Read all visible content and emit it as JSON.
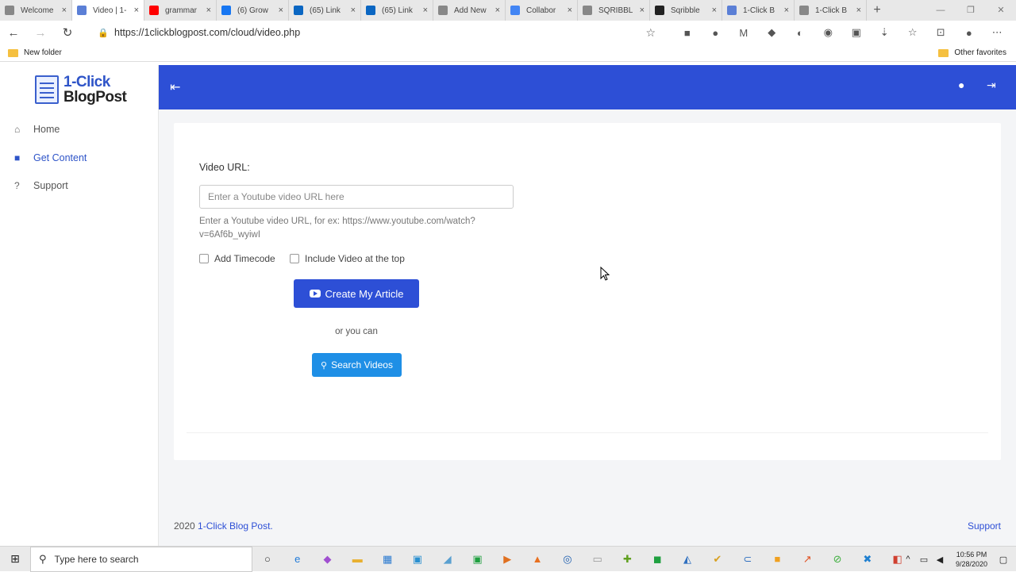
{
  "browser": {
    "tabs": [
      {
        "label": "Welcome",
        "favicon_color": "#888888",
        "active": false
      },
      {
        "label": "Video | 1-",
        "favicon_color": "#5b7fd6",
        "active": true
      },
      {
        "label": "grammar",
        "favicon_color": "#ff0000",
        "active": false
      },
      {
        "label": "(6) Grow",
        "favicon_color": "#1877f2",
        "active": false
      },
      {
        "label": "(65) Link",
        "favicon_color": "#0a66c2",
        "active": false
      },
      {
        "label": "(65) Link",
        "favicon_color": "#0a66c2",
        "active": false
      },
      {
        "label": "Add New",
        "favicon_color": "#888888",
        "active": false
      },
      {
        "label": "Collabor",
        "favicon_color": "#4285f4",
        "active": false
      },
      {
        "label": "SQRIBBL",
        "favicon_color": "#888888",
        "active": false
      },
      {
        "label": "Sqribble",
        "favicon_color": "#222222",
        "active": false
      },
      {
        "label": "1-Click B",
        "favicon_color": "#5b7fd6",
        "active": false
      },
      {
        "label": "1-Click B",
        "favicon_color": "#888888",
        "active": false
      }
    ],
    "tab_close_icon": "×",
    "new_tab_icon": "+",
    "window_controls": [
      "—",
      "❐",
      "✕"
    ],
    "url": "https://1clickblogpost.com/cloud/video.php",
    "bookmarks": {
      "folder": "New folder",
      "other": "Other favorites"
    },
    "extension_icons": [
      "■",
      "●",
      "M",
      "◆",
      "◐",
      "◉",
      "▣",
      "⇣",
      "☆",
      "⊡",
      "●",
      "⋯"
    ]
  },
  "app": {
    "logo": {
      "line1": "1-Click",
      "line2": "BlogPost"
    },
    "menu": [
      {
        "label": "Home",
        "icon": "home-icon",
        "glyph": "⌂"
      },
      {
        "label": "Get Content",
        "icon": "video-camera-icon",
        "glyph": "■"
      },
      {
        "label": "Support",
        "icon": "question-icon",
        "glyph": "?"
      }
    ],
    "form": {
      "label": "Video URL:",
      "placeholder": "Enter a Youtube video URL here",
      "help": "Enter a Youtube video URL, for ex: https://www.youtube.com/watch?v=6Af6b_wyiwI",
      "checkbox1": "Add Timecode",
      "checkbox2": "Include Video at the top",
      "create_button": "Create My Article",
      "or_text": "or you can",
      "search_button": "Search Videos"
    },
    "footer": {
      "prefix": "2020 ",
      "link": "1-Click Blog Post.",
      "support": "Support"
    },
    "accent_color": "#2d4fd6"
  },
  "taskbar": {
    "search_placeholder": "Type here to search",
    "time": "10:56 PM",
    "date": "9/28/2020"
  }
}
